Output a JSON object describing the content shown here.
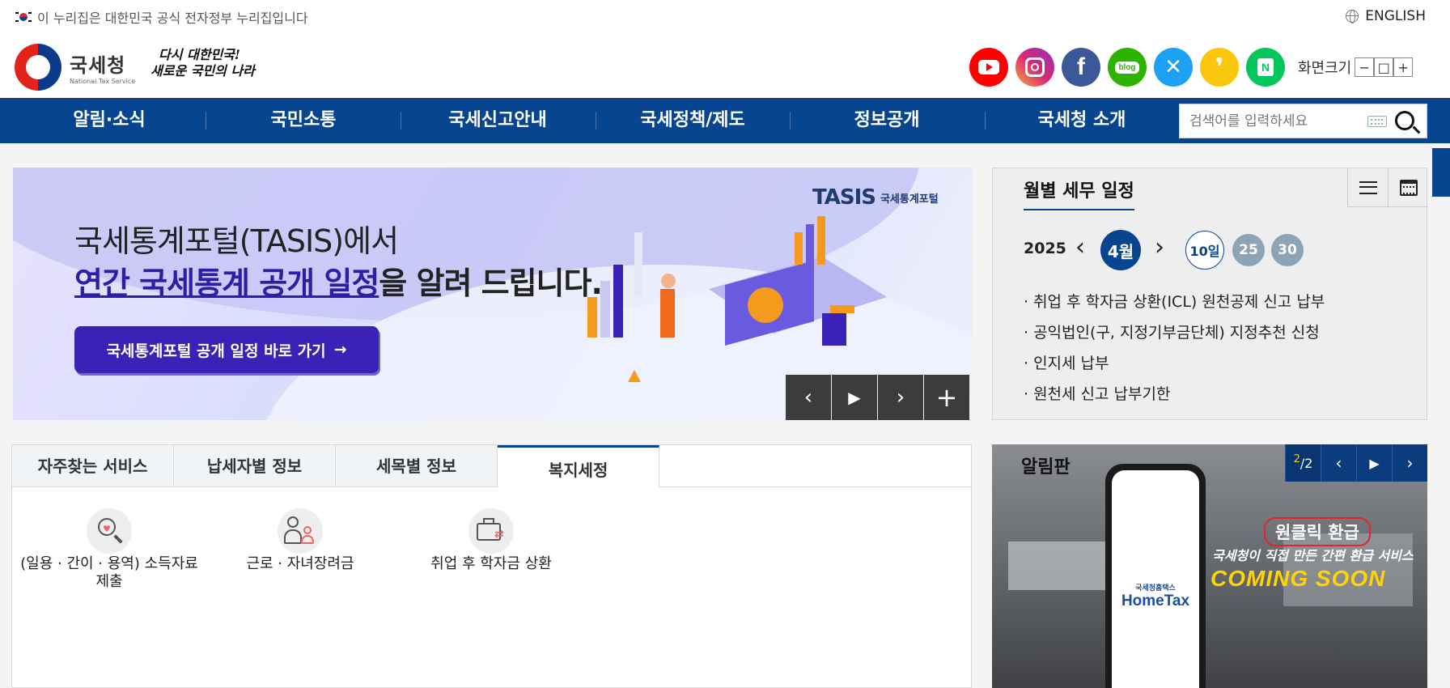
{
  "topbar": {
    "notice": "이 누리집은 대한민국 공식 전자정부 누리집입니다",
    "english": "ENGLISH"
  },
  "header": {
    "logo_ko": "국세청",
    "logo_en": "National Tax Service",
    "slogan_line1": "다시 대한민국!",
    "slogan_line2": "새로운 국민의 나라",
    "sns": [
      {
        "name": "youtube",
        "glyph": "▶",
        "color": "#ff0000"
      },
      {
        "name": "instagram",
        "glyph": "◎",
        "color": "#c13584"
      },
      {
        "name": "facebook",
        "glyph": "f",
        "color": "#3b5998"
      },
      {
        "name": "blog",
        "glyph": "blog",
        "color": "#2db400"
      },
      {
        "name": "x",
        "glyph": "𝕏",
        "color": "#1da1f2"
      },
      {
        "name": "kakao",
        "glyph": "❜",
        "color": "#fee500"
      },
      {
        "name": "naver-post",
        "glyph": "N",
        "color": "#03c75a"
      }
    ],
    "screen_size_label": "화면크기",
    "screen_size_buttons": [
      "−",
      "□",
      "+"
    ]
  },
  "nav": {
    "items": [
      "알림·소식",
      "국민소통",
      "국세신고안내",
      "국세정책/제도",
      "정보공개",
      "국세청 소개"
    ],
    "search_placeholder": "검색어를 입력하세요"
  },
  "banner": {
    "line1": "국세통계포털(TASIS)에서",
    "line2_highlight": "연간 국세통계 공개 일정",
    "line2_rest": "을 알려 드립니다.",
    "button": "국세통계포털 공개 일정 바로 가기",
    "button_arrow": "→",
    "tasis_main": "TASIS",
    "tasis_ko": "국세통계포털",
    "controls": [
      "‹",
      "▶",
      "›",
      "+"
    ]
  },
  "schedule": {
    "title": "월별 세무 일정",
    "year": "2025",
    "month": "4월",
    "prev": "‹",
    "next": "›",
    "days": [
      "10일",
      "25",
      "30"
    ],
    "items": [
      "· 취업 후 학자금 상환(ICL) 원천공제 신고 납부",
      "· 공익법인(구, 지정기부금단체) 지정추천 신청",
      "· 인지세 납부",
      "· 원천세 신고 납부기한"
    ]
  },
  "tabs": {
    "items": [
      "자주찾는 서비스",
      "납세자별 정보",
      "세목별 정보",
      "복지세정"
    ],
    "active_index": 3,
    "services": [
      {
        "label_line1": "(일용 · 간이 · 용역) 소득자료",
        "label_line2": "제출"
      },
      {
        "label_line1": "근로 · 자녀장려금",
        "label_line2": ""
      },
      {
        "label_line1": "취업 후 학자금 상환",
        "label_line2": ""
      }
    ]
  },
  "board": {
    "title": "알림판",
    "count_current": "2",
    "count_total": "/2",
    "controls": [
      "‹",
      "▶",
      "›"
    ],
    "hometax_small": "국세청홈택스",
    "hometax_big": "HomeTax",
    "refund_title": "원클릭 환급",
    "refund_sub": "국세청이 직접 만든 간편 환급 서비스",
    "coming_soon": "COMING SOON"
  },
  "colors": {
    "primary": "#074591",
    "banner_button": "#3a22b7"
  }
}
